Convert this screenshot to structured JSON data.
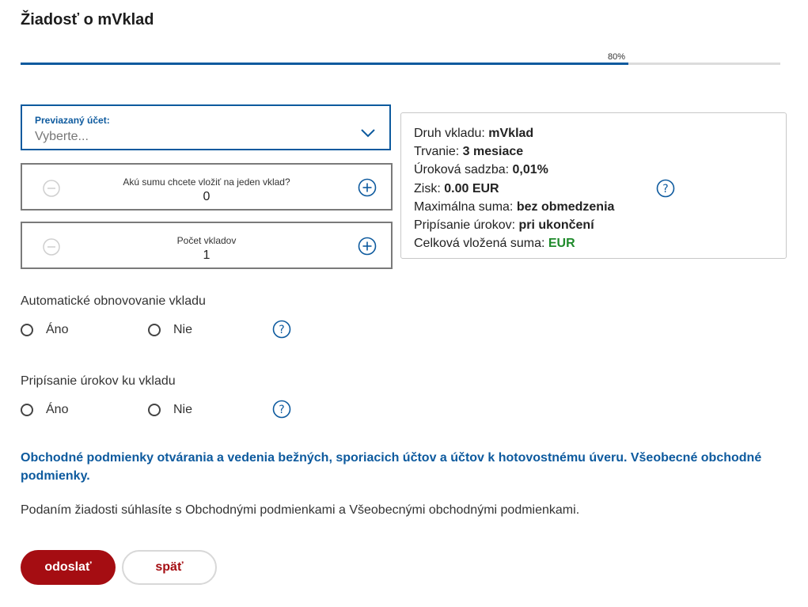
{
  "page": {
    "title": "Žiadosť o mVklad"
  },
  "progress": {
    "label": "80%",
    "value": 0.8
  },
  "linked_account": {
    "label": "Previazaný účet:",
    "placeholder": "Vyberte..."
  },
  "amount_stepper": {
    "label": "Akú sumu chcete vložiť na jeden vklad?",
    "value": "0"
  },
  "count_stepper": {
    "label": "Počet vkladov",
    "value": "1"
  },
  "summary": {
    "type_label": "Druh vkladu:",
    "type_value": "mVklad",
    "duration_label": "Trvanie:",
    "duration_value": "3 mesiace",
    "rate_label": "Úroková sadzba:",
    "rate_value": "0,01%",
    "profit_label": "Zisk:",
    "profit_value": "0.00 EUR",
    "max_label": "Maximálna suma:",
    "max_value": "bez obmedzenia",
    "interest_label": "Pripísanie úrokov:",
    "interest_value": "pri ukončení",
    "total_label": "Celková vložená suma:",
    "total_value": "EUR",
    "total_color": "#1f8a2b"
  },
  "auto_renewal": {
    "label": "Automatické obnovovanie vkladu",
    "yes": "Áno",
    "no": "Nie"
  },
  "interest_crediting": {
    "label": "Pripísanie úrokov ku vkladu",
    "yes": "Áno",
    "no": "Nie"
  },
  "terms_link": "Obchodné podmienky otvárania a vedenia bežných, sporiacich účtov a účtov k hotovostnému úveru. Všeobecné obchodné podmienky.",
  "consent_text": "Podaním žiadosti súhlasíte s Obchodnými podmienkami a Všeobecnými obchodnými podmienkami.",
  "buttons": {
    "submit": "odoslať",
    "back": "späť"
  },
  "colors": {
    "accent": "#0d5a9e",
    "primary": "#a50d12"
  }
}
